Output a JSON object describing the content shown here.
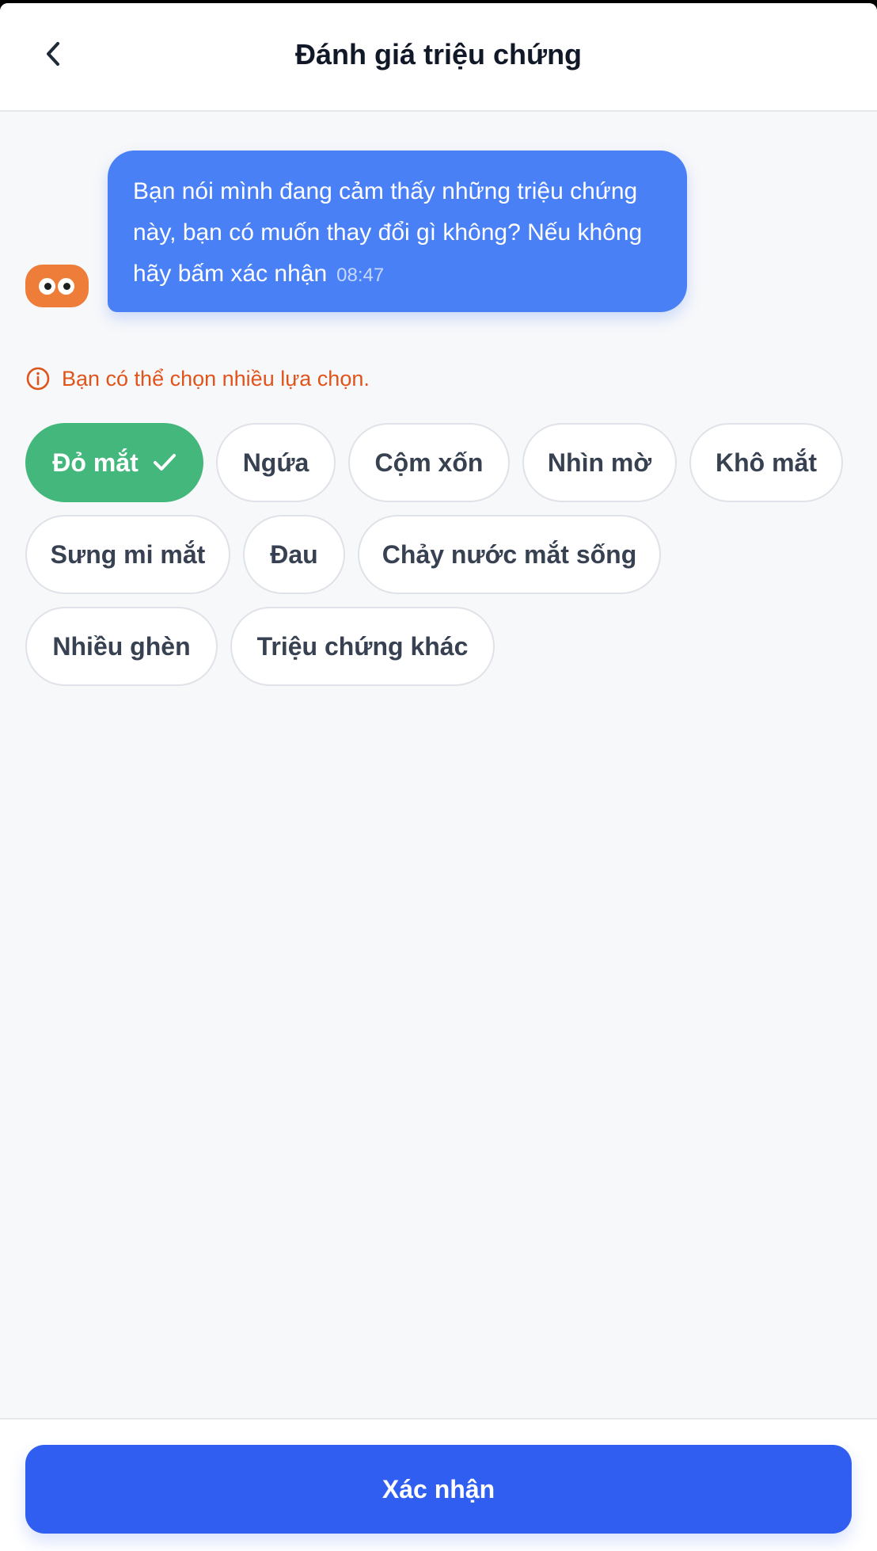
{
  "header": {
    "title": "Đánh giá triệu chứng"
  },
  "message": {
    "text": "Bạn nói mình đang cảm thấy những triệu chứng này, bạn có muốn thay đổi gì không? Nếu không hãy bấm xác nhận",
    "time": "08:47"
  },
  "hint": {
    "text": "Bạn có thể chọn nhiều lựa chọn."
  },
  "symptoms": [
    {
      "label": "Đỏ mắt",
      "selected": true
    },
    {
      "label": "Ngứa",
      "selected": false
    },
    {
      "label": "Cộm xốn",
      "selected": false
    },
    {
      "label": "Nhìn mờ",
      "selected": false
    },
    {
      "label": "Khô mắt",
      "selected": false
    },
    {
      "label": "Sưng mi mắt",
      "selected": false
    },
    {
      "label": "Đau",
      "selected": false
    },
    {
      "label": "Chảy nước mắt sống",
      "selected": false
    },
    {
      "label": "Nhiều ghèn",
      "selected": false
    },
    {
      "label": "Triệu chứng khác",
      "selected": false
    }
  ],
  "footer": {
    "confirm_label": "Xác nhận"
  },
  "colors": {
    "accent": "#2f5ef0",
    "bubble": "#4a80f6",
    "selected_chip": "#43b77c",
    "hint": "#e0531b",
    "avatar": "#ef7d3a"
  },
  "icons": {
    "back": "chevron-left-icon",
    "info": "info-circle-icon",
    "check": "check-icon"
  }
}
